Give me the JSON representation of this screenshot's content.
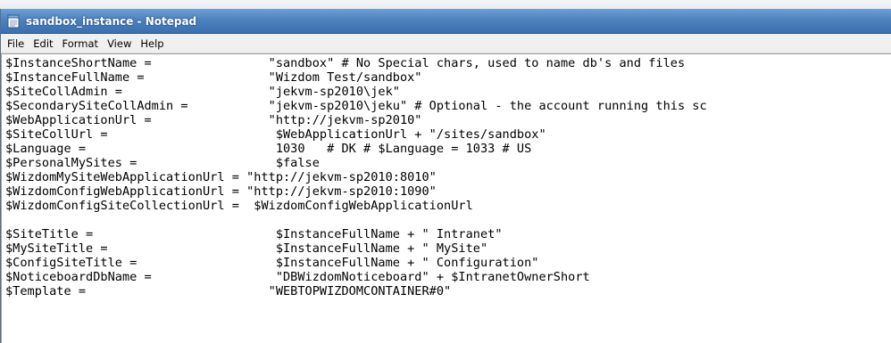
{
  "window": {
    "title": "sandbox_instance - Notepad",
    "icon": "notepad-icon"
  },
  "menu": {
    "items": [
      {
        "label": "File"
      },
      {
        "label": "Edit"
      },
      {
        "label": "Format"
      },
      {
        "label": "View"
      },
      {
        "label": "Help"
      }
    ]
  },
  "editor": {
    "lines": [
      "$InstanceShortName =                \"sandbox\" # No Special chars, used to name db's and files",
      "$InstanceFullName =                 \"Wizdom Test/sandbox\"",
      "$SiteCollAdmin =                    \"jekvm-sp2010\\jek\"",
      "$SecondarySiteCollAdmin =           \"jekvm-sp2010\\jeku\" # Optional - the account running this sc",
      "$WebApplicationUrl =                \"http://jekvm-sp2010\"",
      "$SiteCollUrl =                       $WebApplicationUrl + \"/sites/sandbox\"",
      "$Language =                          1030   # DK # $Language = 1033 # US",
      "$PersonalMySites =                   $false",
      "$WizdomMySiteWebApplicationUrl = \"http://jekvm-sp2010:8010\"",
      "$WizdomConfigWebApplicationUrl = \"http://jekvm-sp2010:1090\"",
      "$WizdomConfigSiteCollectionUrl =  $WizdomConfigWebApplicationUrl",
      "",
      "$SiteTitle =                         $InstanceFullName + \" Intranet\"",
      "$MySiteTitle =                       $InstanceFullName + \" MySite\"",
      "$ConfigSiteTitle =                   $InstanceFullName + \" Configuration\"",
      "$NoticeboardDbName =                 \"DBWizdomNoticeboard\" + $IntranetOwnerShort",
      "$Template =                         \"WEBTOPWIZDOMCONTAINER#0\""
    ]
  },
  "colors": {
    "titlebar": "#4d82c0",
    "title_text": "#ffffff",
    "menubar": "#f0f0f0",
    "editor_bg": "#ffffff"
  }
}
